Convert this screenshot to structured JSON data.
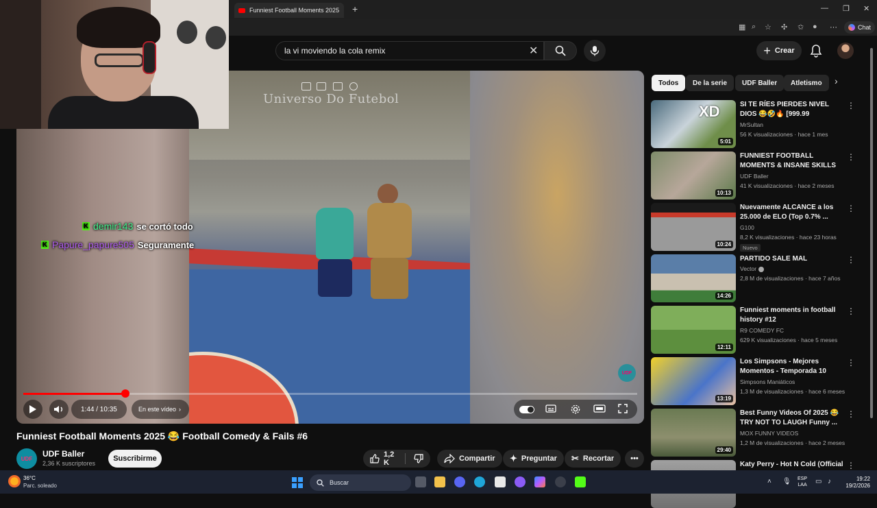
{
  "browser": {
    "tab_title": "Funniest Football Moments 2025 😂",
    "new_tab_symbol": "+",
    "copilot_label": "Chat"
  },
  "header": {
    "search_value": "la vi moviendo la cola remix",
    "create_label": "Crear"
  },
  "player": {
    "watermark": "Universo Do Futebol",
    "progress_fraction": 0.166,
    "time_display": "1:44 / 10:35",
    "chapter_label": "En este vídeo",
    "logo_text": "UDF"
  },
  "chat": [
    {
      "user": "demir143",
      "message": "se cortó todo",
      "color": "#41f28c"
    },
    {
      "user": "Papure_papure505",
      "message": "Seguramente",
      "color": "#b05cf0"
    }
  ],
  "video": {
    "title": "Funniest Football Moments 2025 😂 Football Comedy & Fails #6",
    "channel": "UDF Baller",
    "subscribers": "2,36 K suscriptores",
    "subscribe_label": "Suscribirme",
    "like_count": "1,2 K",
    "share_label": "Compartir",
    "ask_label": "Preguntar",
    "clip_label": "Recortar",
    "avatar_text": "UDF"
  },
  "chips": [
    "Todos",
    "De la serie",
    "UDF Baller",
    "Atletismo"
  ],
  "recommendations": [
    {
      "title": "SI TE RÍES PIERDES NIVEL DIOS 😂🤣🔥 [999.99 IMPOSIBLE ...",
      "channel": "MrSultan",
      "meta": "56 K visualizaciones · hace 1 mes",
      "duration": "5:01",
      "thumb_text": "XD",
      "badge": ""
    },
    {
      "title": "FUNNIEST FOOTBALL MOMENTS & INSANE SKILLS -...",
      "channel": "UDF Baller",
      "meta": "41 K visualizaciones · hace 2 meses",
      "duration": "10:13",
      "thumb_text": "",
      "badge": ""
    },
    {
      "title": "Nuevamente ALCANCE a los 25.000 de ELO (Top 0.7% ...",
      "channel": "G100",
      "meta": "8,2 K visualizaciones · hace 23 horas",
      "duration": "10:24",
      "thumb_text": "",
      "badge": "Nuevo"
    },
    {
      "title": "PARTIDO SALE MAL",
      "channel": "Vector",
      "meta": "2,8 M de visualizaciones · hace 7 años",
      "duration": "14:26",
      "thumb_text": "",
      "badge": ""
    },
    {
      "title": "Funniest moments in football history #12",
      "channel": "R9 COMEDY FC",
      "meta": "629 K visualizaciones · hace 5 meses",
      "duration": "12:11",
      "thumb_text": "",
      "badge": ""
    },
    {
      "title": "Los Simpsons - Mejores Momentos - Temporada 10",
      "channel": "Simpsons Maniáticos",
      "meta": "1,3 M de visualizaciones · hace 6 meses",
      "duration": "13:19",
      "thumb_text": "",
      "badge": ""
    },
    {
      "title": "Best Funny Videos Of 2025 😂 TRY NOT TO LAUGH Funny ...",
      "channel": "MOX FUNNY VIDEOS",
      "meta": "1,2 M de visualizaciones · hace 2 meses",
      "duration": "29:40",
      "thumb_text": "",
      "badge": ""
    },
    {
      "title": "Katy Perry - Hot N Cold (Official",
      "channel": "",
      "meta": "",
      "duration": "",
      "thumb_text": "",
      "badge": ""
    }
  ],
  "taskbar": {
    "temperature": "36°C",
    "weather": "Parc. soleado",
    "search_placeholder": "Buscar",
    "lang_top": "ESP",
    "lang_bottom": "LAA",
    "time": "19:22",
    "date": "19/2/2026"
  },
  "colors": {
    "background": "#0f0f0f",
    "progress": "#ff0000",
    "chip_active": "#f1f1f1"
  }
}
